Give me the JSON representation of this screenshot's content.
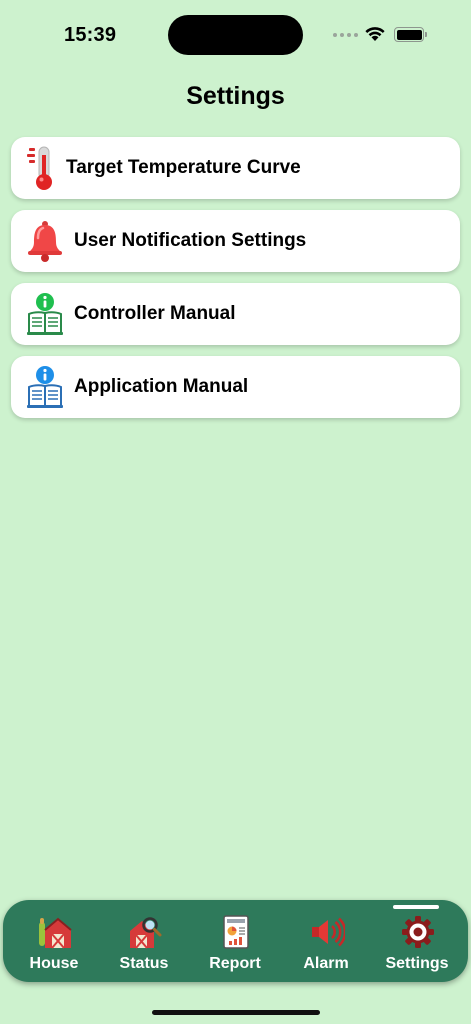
{
  "status_bar": {
    "time": "15:39"
  },
  "page": {
    "title": "Settings"
  },
  "menu": [
    {
      "label": "Target Temperature Curve",
      "icon": "thermometer-icon"
    },
    {
      "label": "User Notification Settings",
      "icon": "bell-icon"
    },
    {
      "label": "Controller Manual",
      "icon": "manual-book-green-icon"
    },
    {
      "label": "Application Manual",
      "icon": "manual-book-blue-icon"
    }
  ],
  "tabs": [
    {
      "label": "House",
      "icon": "barn-icon"
    },
    {
      "label": "Status",
      "icon": "barn-search-icon"
    },
    {
      "label": "Report",
      "icon": "report-icon"
    },
    {
      "label": "Alarm",
      "icon": "speaker-icon"
    },
    {
      "label": "Settings",
      "icon": "gear-icon",
      "selected": true
    }
  ],
  "colors": {
    "background": "#cdf2ce",
    "tab_bar": "#2e7a5b",
    "card": "#ffffff"
  }
}
